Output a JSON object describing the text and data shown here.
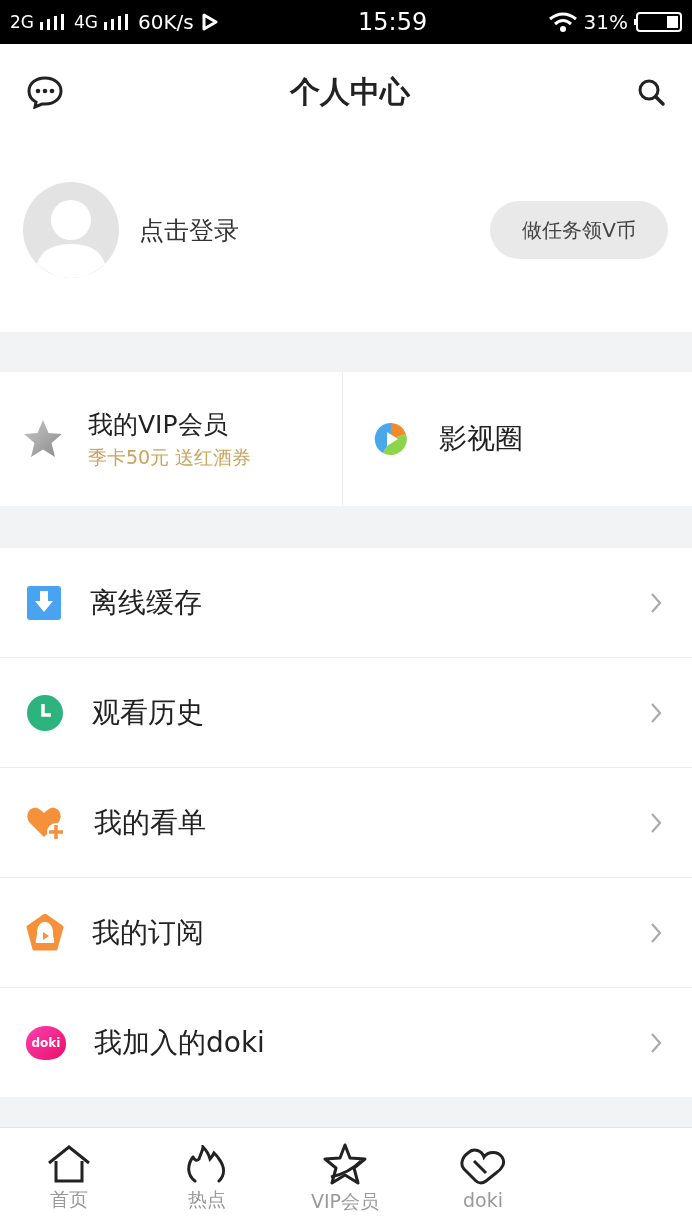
{
  "status_bar": {
    "network_1": "2G",
    "network_2": "4G",
    "speed": "60K/s",
    "time": "15:59",
    "battery": "31%"
  },
  "header": {
    "title": "个人中心"
  },
  "profile": {
    "login": "点击登录",
    "task_button": "做任务领V币"
  },
  "shortcuts": [
    {
      "kind": "vip",
      "title": "我的VIP会员",
      "subtitle": "季卡50元 送红酒券"
    },
    {
      "kind": "circle",
      "title": "影视圈"
    }
  ],
  "menu": [
    {
      "kind": "download",
      "label": "离线缓存"
    },
    {
      "kind": "clock",
      "label": "观看历史"
    },
    {
      "kind": "heart",
      "label": "我的看单"
    },
    {
      "kind": "subscribe",
      "label": "我的订阅"
    },
    {
      "kind": "doki",
      "label": "我加入的doki",
      "badge": "doki"
    }
  ],
  "tab_bar": [
    {
      "kind": "home",
      "label": "首页"
    },
    {
      "kind": "flame",
      "label": "热点"
    },
    {
      "kind": "star",
      "label": "VIP会员"
    },
    {
      "kind": "doki",
      "label": "doki"
    }
  ]
}
